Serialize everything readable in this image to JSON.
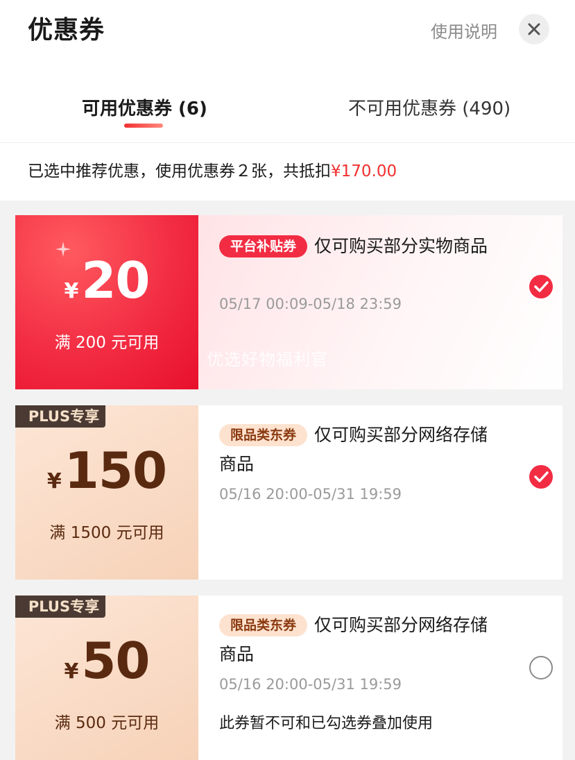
{
  "header": {
    "title": "优惠券",
    "help_label": "使用说明",
    "close_icon": "close-icon"
  },
  "tabs": [
    {
      "label": "可用优惠券 (6)",
      "active": true
    },
    {
      "label": "不可用优惠券 (490)",
      "active": false
    }
  ],
  "summary": {
    "text": "已选中推荐优惠，使用优惠券２张，共抵扣",
    "amount": "¥170.00"
  },
  "colors": {
    "accent": "#f23030",
    "plus_badge_bg": "#4a3a33",
    "tan_bg": "#f6d2b8"
  },
  "coupons": [
    {
      "currency": "¥",
      "value": "20",
      "threshold": "满 200 元可用",
      "tag": "平台补贴券",
      "desc_line1": "仅可购买部分实物商品",
      "desc_line2": "",
      "date": "05/17 00:09-05/18 23:59",
      "watermark": "优选好物福利官",
      "selected": true
    },
    {
      "badge": "PLUS专享",
      "currency": "¥",
      "value": "150",
      "threshold": "满 1500 元可用",
      "tag": "限品类东券",
      "desc_line1": "仅可购买部分网络存储",
      "desc_line2": "商品",
      "date": "05/16 20:00-05/31 19:59",
      "selected": true
    },
    {
      "badge": "PLUS专享",
      "currency": "¥",
      "value": "50",
      "threshold": "满 500 元可用",
      "tag": "限品类东券",
      "desc_line1": "仅可购买部分网络存储",
      "desc_line2": "商品",
      "date": "05/16 20:00-05/31 19:59",
      "note": "此券暂不可和已勾选券叠加使用",
      "selected": false
    }
  ]
}
